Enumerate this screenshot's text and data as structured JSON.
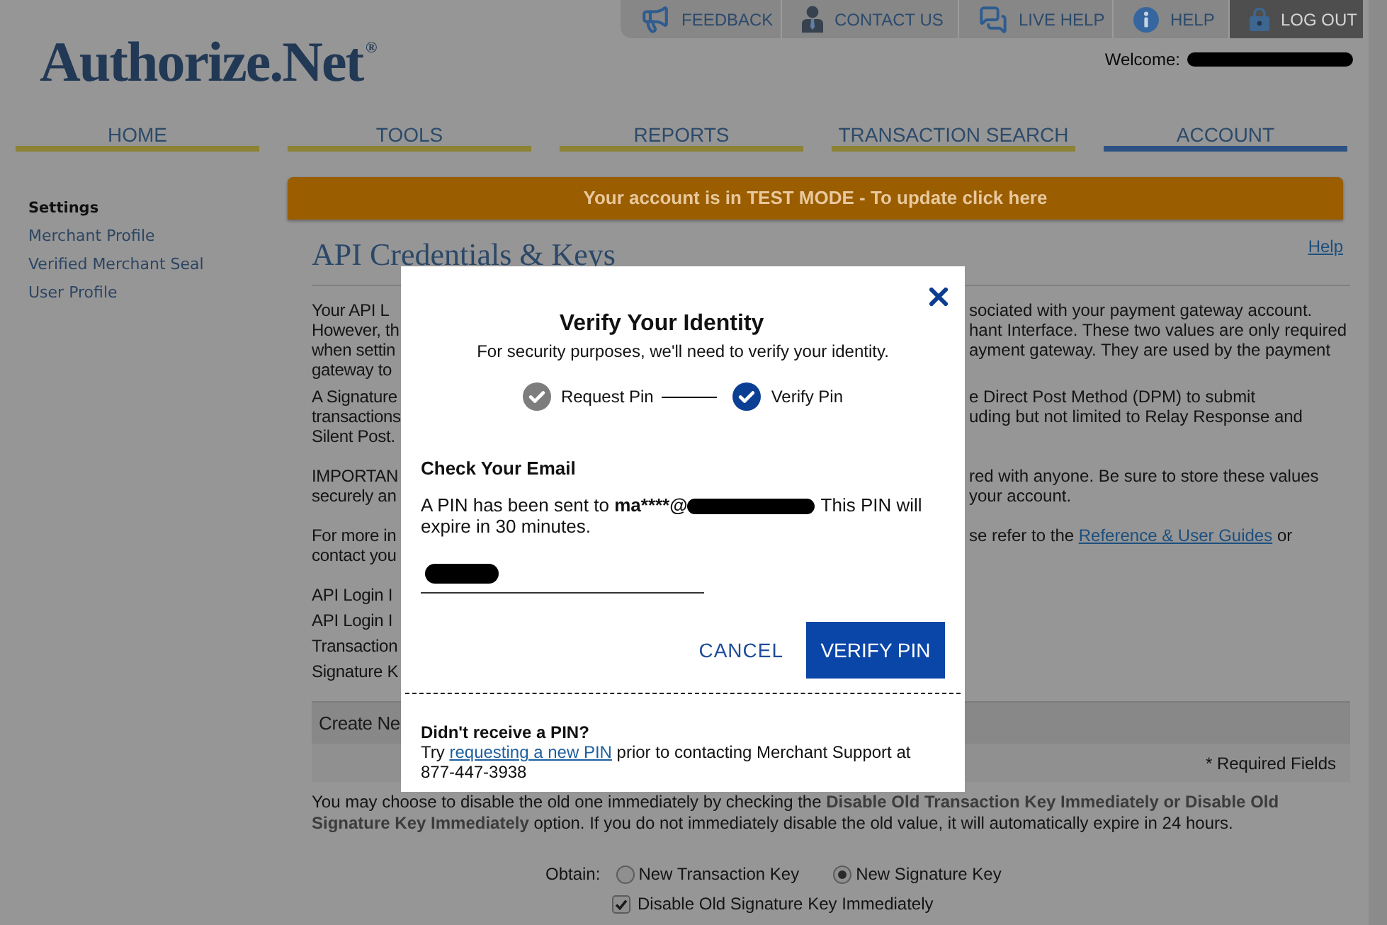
{
  "utility_links": [
    {
      "label": "FEEDBACK",
      "kind": "feedback"
    },
    {
      "label": "CONTACT US",
      "kind": "contact"
    },
    {
      "label": "LIVE HELP",
      "kind": "chat"
    },
    {
      "label": "HELP",
      "kind": "help"
    },
    {
      "label": "LOG OUT",
      "kind": "logout"
    }
  ],
  "logo": "Authorize.Net$^{®}$",
  "welcome": "Welcome:",
  "nav_tabs": [
    {
      "label": "HOME",
      "selected": false
    },
    {
      "label": "TOOLS",
      "selected": false
    },
    {
      "label": "REPORTS",
      "selected": false
    },
    {
      "label": "TRANSACTION SEARCH",
      "selected": false
    },
    {
      "label": "ACCOUNT",
      "selected": true
    }
  ],
  "sidebar": {
    "heading": "Settings",
    "items": [
      "Merchant Profile",
      "Verified Merchant Seal",
      "User Profile"
    ]
  },
  "banner": "Your account is in TEST MODE - To update click here",
  "page": {
    "title": "API Credentials & Keys",
    "help_link": "Help",
    "paragraphs": [
      {
        "lines": [
          {
            "left": "Your API L",
            "right": "sociated with your payment gateway account."
          },
          {
            "left": "However, th",
            "right": "hant Interface. These two values are only required"
          },
          {
            "left": "when settin",
            "right": "ayment gateway. They are used by the payment"
          },
          {
            "left": "gateway to"
          }
        ]
      },
      {
        "lines": [
          {
            "left": "A Signature",
            "right": "e Direct Post Method (DPM) to submit"
          },
          {
            "left": "transactions",
            "right": "uding but not limited to Relay Response and"
          },
          {
            "left": "Silent Post."
          }
        ]
      },
      {
        "lines": [
          {
            "left": "IMPORTAN",
            "right": "red with anyone. Be sure to store these values"
          },
          {
            "left": "securely an",
            "right": "your account."
          }
        ]
      },
      {
        "lines": [
          {
            "left": "For more in",
            "right": "se refer to the ",
            "link": "Reference & User Guides",
            "right_end": " or"
          },
          {
            "left": "contact you"
          }
        ]
      }
    ],
    "field_labels": [
      "API Login I",
      "API Login I",
      "Transaction",
      "Signature K"
    ],
    "create_section": {
      "title": "Create Ne",
      "required_note": "* Required Fields"
    },
    "disable_note": "You may choose to disable the old one immediately by checking the **Disable Old Transaction Key Immediately or Disable Old Signature Key Immediately** option. If you do not immediately disable the old value, it will automatically expire in 24 hours.",
    "obtain": {
      "label": "Obtain:",
      "options": [
        {
          "label": "New Transaction Key",
          "selected": false
        },
        {
          "label": "New Signature Key",
          "selected": true
        }
      ]
    },
    "disable_old": {
      "label": "Disable Old Signature Key Immediately",
      "checked": true
    }
  },
  "modal": {
    "title": "Verify Your Identity",
    "subtitle": "For security purposes, we'll need to verify your identity.",
    "steps": [
      {
        "label": "Request Pin",
        "active": false
      },
      {
        "label": "Verify Pin",
        "active": true
      }
    ],
    "section_title": "Check Your Email",
    "message_prefix": "A PIN has been sent to ",
    "masked_email": "ma****@",
    "message_suffix": "This PIN will expire in 30 minutes.",
    "cancel": "CANCEL",
    "verify": "VERIFY PIN",
    "help_title": "Didn't receive a PIN?",
    "help_before": "Try ",
    "help_link": "requesting a new PIN",
    "help_after": " prior to contacting Merchant Support at 877-447-3938"
  }
}
